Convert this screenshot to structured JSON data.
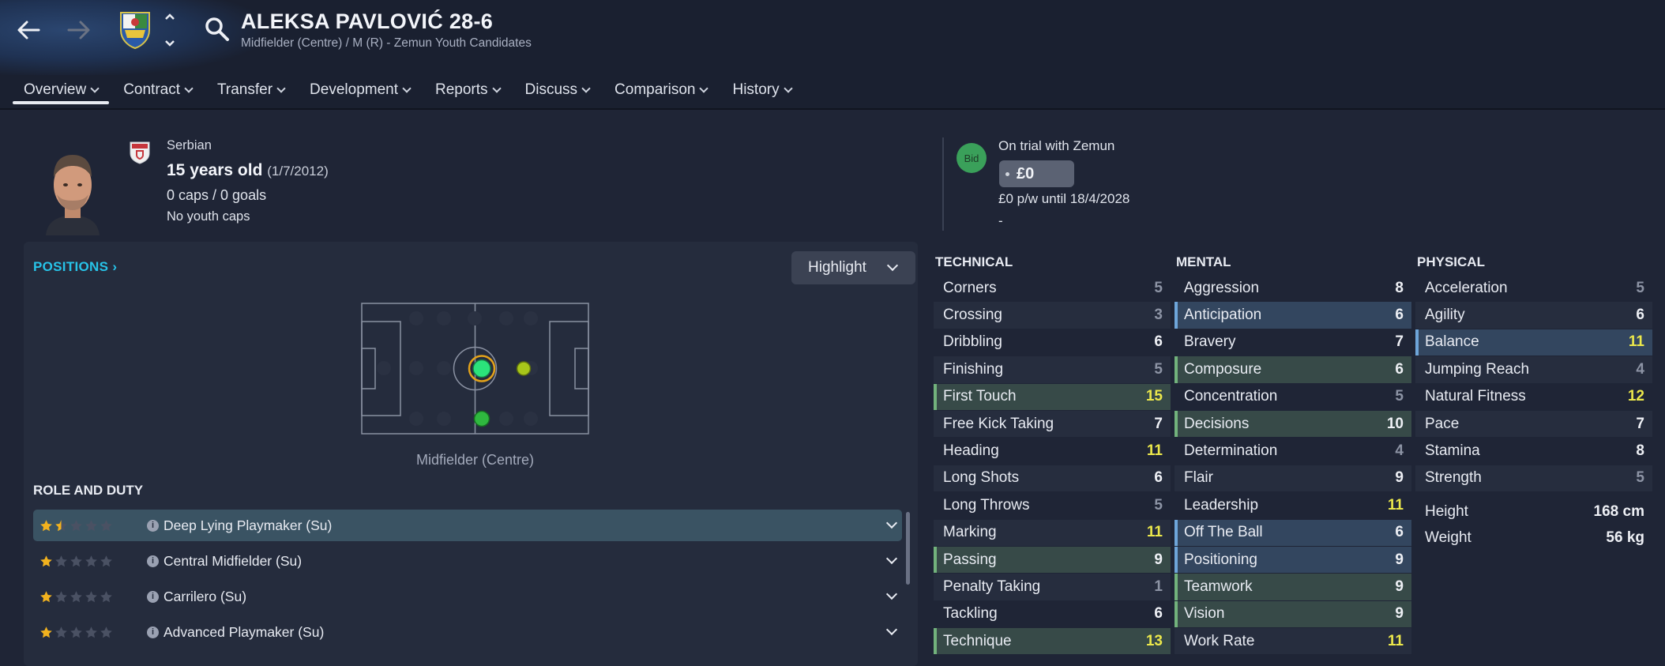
{
  "header": {
    "player_name": "ALEKSA PAVLOVIĆ 28-6",
    "subtitle": "Midfielder (Centre) / M (R) - Zemun Youth Candidates"
  },
  "tabs": [
    {
      "label": "Overview",
      "active": true
    },
    {
      "label": "Contract"
    },
    {
      "label": "Transfer"
    },
    {
      "label": "Development"
    },
    {
      "label": "Reports"
    },
    {
      "label": "Discuss"
    },
    {
      "label": "Comparison"
    },
    {
      "label": "History"
    }
  ],
  "bio": {
    "nationality": "Serbian",
    "age": "15 years old",
    "dob": "(1/7/2012)",
    "caps": "0 caps / 0 goals",
    "youth_caps": "No youth caps"
  },
  "contract": {
    "bid_label": "Bid",
    "status": "On trial with Zemun",
    "value": "£0",
    "wage": "£0 p/w until 18/4/2028",
    "extra": "-"
  },
  "positions": {
    "title": "POSITIONS",
    "highlight_label": "Highlight",
    "selected_position": "Midfielder (Centre)"
  },
  "roles": {
    "title": "ROLE AND DUTY",
    "items": [
      {
        "label": "Deep Lying Playmaker (Su)",
        "stars": 1.5,
        "selected": true
      },
      {
        "label": "Central Midfielder (Su)",
        "stars": 1
      },
      {
        "label": "Carrilero (Su)",
        "stars": 1
      },
      {
        "label": "Advanced Playmaker (Su)",
        "stars": 1
      }
    ]
  },
  "attributes": {
    "technical": {
      "title": "TECHNICAL",
      "items": [
        {
          "name": "Corners",
          "value": "5"
        },
        {
          "name": "Crossing",
          "value": "3"
        },
        {
          "name": "Dribbling",
          "value": "6"
        },
        {
          "name": "Finishing",
          "value": "5"
        },
        {
          "name": "First Touch",
          "value": "15",
          "hl": "green"
        },
        {
          "name": "Free Kick Taking",
          "value": "7"
        },
        {
          "name": "Heading",
          "value": "11"
        },
        {
          "name": "Long Shots",
          "value": "6"
        },
        {
          "name": "Long Throws",
          "value": "5"
        },
        {
          "name": "Marking",
          "value": "11"
        },
        {
          "name": "Passing",
          "value": "9",
          "hl": "green"
        },
        {
          "name": "Penalty Taking",
          "value": "1"
        },
        {
          "name": "Tackling",
          "value": "6"
        },
        {
          "name": "Technique",
          "value": "13",
          "hl": "green"
        }
      ]
    },
    "mental": {
      "title": "MENTAL",
      "items": [
        {
          "name": "Aggression",
          "value": "8"
        },
        {
          "name": "Anticipation",
          "value": "6",
          "hl": "blue"
        },
        {
          "name": "Bravery",
          "value": "7"
        },
        {
          "name": "Composure",
          "value": "6",
          "hl": "green"
        },
        {
          "name": "Concentration",
          "value": "5"
        },
        {
          "name": "Decisions",
          "value": "10",
          "hl": "green"
        },
        {
          "name": "Determination",
          "value": "4"
        },
        {
          "name": "Flair",
          "value": "9"
        },
        {
          "name": "Leadership",
          "value": "11"
        },
        {
          "name": "Off The Ball",
          "value": "6",
          "hl": "blue"
        },
        {
          "name": "Positioning",
          "value": "9",
          "hl": "blue"
        },
        {
          "name": "Teamwork",
          "value": "9",
          "hl": "green"
        },
        {
          "name": "Vision",
          "value": "9",
          "hl": "green"
        },
        {
          "name": "Work Rate",
          "value": "11"
        }
      ]
    },
    "physical": {
      "title": "PHYSICAL",
      "items": [
        {
          "name": "Acceleration",
          "value": "5"
        },
        {
          "name": "Agility",
          "value": "6"
        },
        {
          "name": "Balance",
          "value": "11",
          "hl": "blue"
        },
        {
          "name": "Jumping Reach",
          "value": "4"
        },
        {
          "name": "Natural Fitness",
          "value": "12"
        },
        {
          "name": "Pace",
          "value": "7"
        },
        {
          "name": "Stamina",
          "value": "8"
        },
        {
          "name": "Strength",
          "value": "5"
        }
      ],
      "height_label": "Height",
      "height": "168 cm",
      "weight_label": "Weight",
      "weight": "56 kg"
    }
  },
  "colors": {
    "accent_cyan": "#27c3e8",
    "high_value": "#ece84b",
    "low_value": "#8d94a5",
    "natural_position": "#2be37b",
    "secondary_position": "#a8c61a",
    "tertiary_position": "#2fb83f"
  }
}
